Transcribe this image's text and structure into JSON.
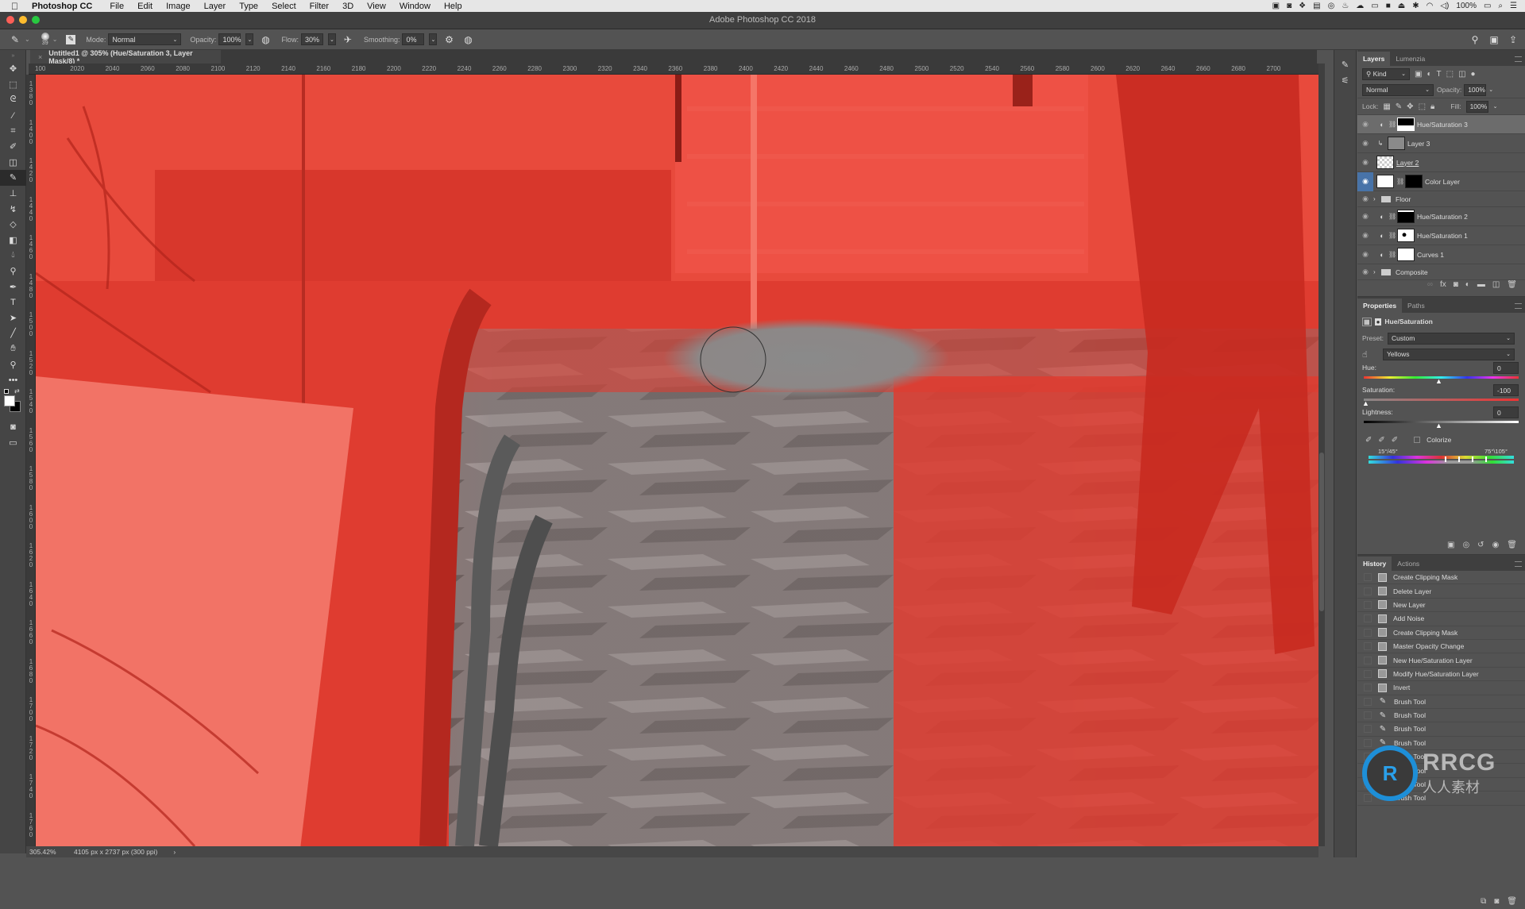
{
  "menubar": {
    "app_name": "Photoshop CC",
    "items": [
      "File",
      "Edit",
      "Image",
      "Layer",
      "Type",
      "Select",
      "Filter",
      "3D",
      "View",
      "Window",
      "Help"
    ],
    "battery": "100%"
  },
  "window": {
    "title": "Adobe Photoshop CC 2018"
  },
  "options": {
    "brush_size": "39",
    "mode_label": "Mode:",
    "mode_value": "Normal",
    "opacity_label": "Opacity:",
    "opacity_value": "100%",
    "flow_label": "Flow:",
    "flow_value": "30%",
    "smoothing_label": "Smoothing:",
    "smoothing_value": "0%"
  },
  "document": {
    "tab_title": "Untitled1 @ 305% (Hue/Saturation 3, Layer Mask/8) *",
    "zoom": "305.42%",
    "info": "4105 px x 2737 px (300 ppi)"
  },
  "ruler": {
    "top": [
      "100",
      "2020",
      "2040",
      "2060",
      "2080",
      "2100",
      "2120",
      "2140",
      "2160",
      "2180",
      "2200",
      "2220",
      "2240",
      "2260",
      "2280",
      "2300",
      "2320",
      "2340",
      "2360",
      "2380",
      "2400",
      "2420",
      "2440",
      "2460",
      "2480",
      "2500",
      "2520",
      "2540",
      "2560",
      "2580",
      "2600",
      "2620",
      "2640",
      "2660",
      "2680",
      "2700"
    ],
    "left": [
      "1380",
      "1400",
      "1420",
      "1440",
      "1460",
      "1480",
      "1500",
      "1520",
      "1540",
      "1560",
      "1580",
      "1600",
      "1620",
      "1640",
      "1660",
      "1680",
      "1700",
      "1720",
      "1740",
      "1760"
    ]
  },
  "layers_panel": {
    "tabs": [
      "Layers",
      "Lumenzia"
    ],
    "filter_kind": "Kind",
    "blend_mode": "Normal",
    "opacity_label": "Opacity:",
    "opacity_value": "100%",
    "lock_label": "Lock:",
    "fill_label": "Fill:",
    "fill_value": "100%",
    "layers": [
      {
        "name": "Hue/Saturation 3",
        "type": "adjustment",
        "selected": true
      },
      {
        "name": "Layer 3",
        "type": "clipped"
      },
      {
        "name": "Layer 2",
        "type": "pixel"
      },
      {
        "name": "Color Layer",
        "type": "fill"
      },
      {
        "name": "Floor",
        "type": "group"
      },
      {
        "name": "Hue/Saturation 2",
        "type": "adjustment"
      },
      {
        "name": "Hue/Saturation 1",
        "type": "adjustment"
      },
      {
        "name": "Curves 1",
        "type": "adjustment"
      },
      {
        "name": "Composite",
        "type": "group"
      }
    ]
  },
  "properties_panel": {
    "tabs": [
      "Properties",
      "Paths"
    ],
    "title": "Hue/Saturation",
    "preset_label": "Preset:",
    "preset_value": "Custom",
    "channel_value": "Yellows",
    "hue_label": "Hue:",
    "hue_value": "0",
    "saturation_label": "Saturation:",
    "saturation_value": "-100",
    "lightness_label": "Lightness:",
    "lightness_value": "0",
    "colorize_label": "Colorize",
    "colorize_checked": false,
    "range_left": "15°/45°",
    "range_right": "75°\\105°"
  },
  "history_panel": {
    "tabs": [
      "History",
      "Actions"
    ],
    "items": [
      {
        "label": "Create Clipping Mask",
        "icon": "snapshot"
      },
      {
        "label": "Delete Layer",
        "icon": "snapshot"
      },
      {
        "label": "New Layer",
        "icon": "snapshot"
      },
      {
        "label": "Add Noise",
        "icon": "snapshot"
      },
      {
        "label": "Create Clipping Mask",
        "icon": "snapshot"
      },
      {
        "label": "Master Opacity Change",
        "icon": "snapshot"
      },
      {
        "label": "New Hue/Saturation Layer",
        "icon": "snapshot"
      },
      {
        "label": "Modify Hue/Saturation Layer",
        "icon": "snapshot"
      },
      {
        "label": "Invert",
        "icon": "snapshot"
      },
      {
        "label": "Brush Tool",
        "icon": "brush"
      },
      {
        "label": "Brush Tool",
        "icon": "brush"
      },
      {
        "label": "Brush Tool",
        "icon": "brush"
      },
      {
        "label": "Brush Tool",
        "icon": "brush"
      },
      {
        "label": "Brush Tool",
        "icon": "brush"
      },
      {
        "label": "Brush Tool",
        "icon": "brush"
      },
      {
        "label": "Brush Tool",
        "icon": "brush"
      },
      {
        "label": "Brush Tool",
        "icon": "brush"
      }
    ]
  },
  "watermark": {
    "brand": "RRCG",
    "sub": "人人素材"
  },
  "colors": {
    "canvas_red": "#e23b2e",
    "selection_blue": "#4873a8",
    "panel_bg": "#535353"
  }
}
